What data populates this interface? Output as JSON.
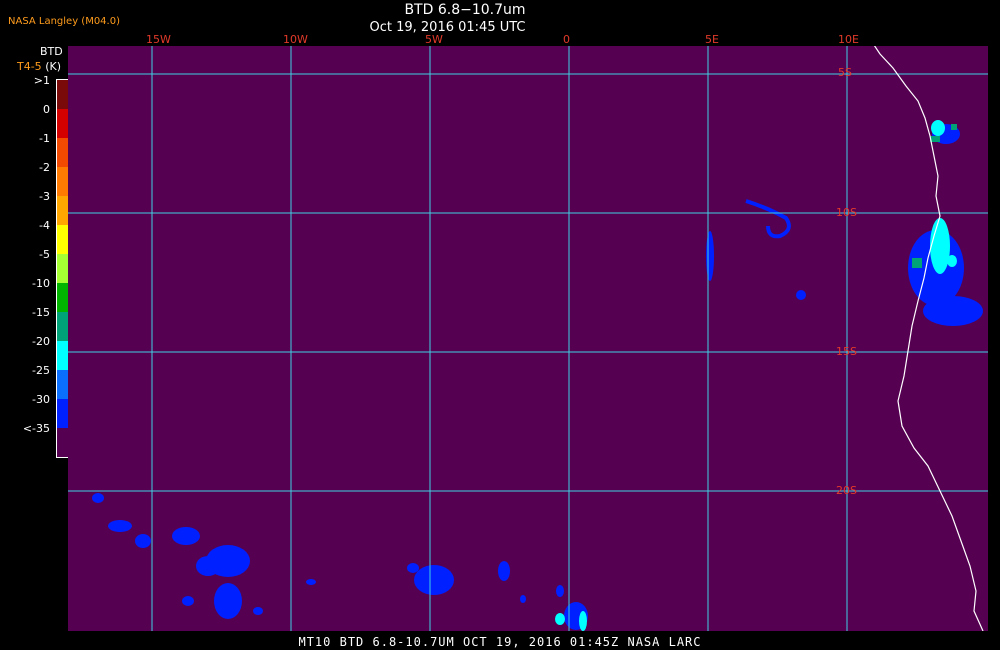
{
  "header": {
    "title": "BTD 6.8−10.7um",
    "subtitle": "Oct 19, 2016 01:45 UTC",
    "org": "NASA Langley (M04.0)"
  },
  "legend": {
    "title": "BTD",
    "units_label": "T4-5",
    "units": "(K)",
    "labels": [
      ">1",
      "0",
      "-1",
      "-2",
      "-3",
      "-4",
      "-5",
      "-10",
      "-15",
      "-20",
      "-25",
      "-30",
      "<-35"
    ],
    "colors": [
      "#7a0a0a",
      "#d40000",
      "#f24a00",
      "#ff7a00",
      "#ffa600",
      "#ffff00",
      "#a6ff33",
      "#00b400",
      "#00a278",
      "#00ffff",
      "#0a6eff",
      "#0020ff",
      "#560052"
    ]
  },
  "map": {
    "background_color": "#560052",
    "grid_color": "#3fd0e0",
    "coast_color": "#ffffff",
    "lon_labels": [
      "15W",
      "10W",
      "5W",
      "0",
      "5E",
      "10E"
    ],
    "lat_labels": [
      "5S",
      "10S",
      "15S",
      "20S"
    ]
  },
  "footer": {
    "text": "MT10  BTD 6.8-10.7UM   OCT 19, 2016 01:45Z   NASA LARC"
  }
}
